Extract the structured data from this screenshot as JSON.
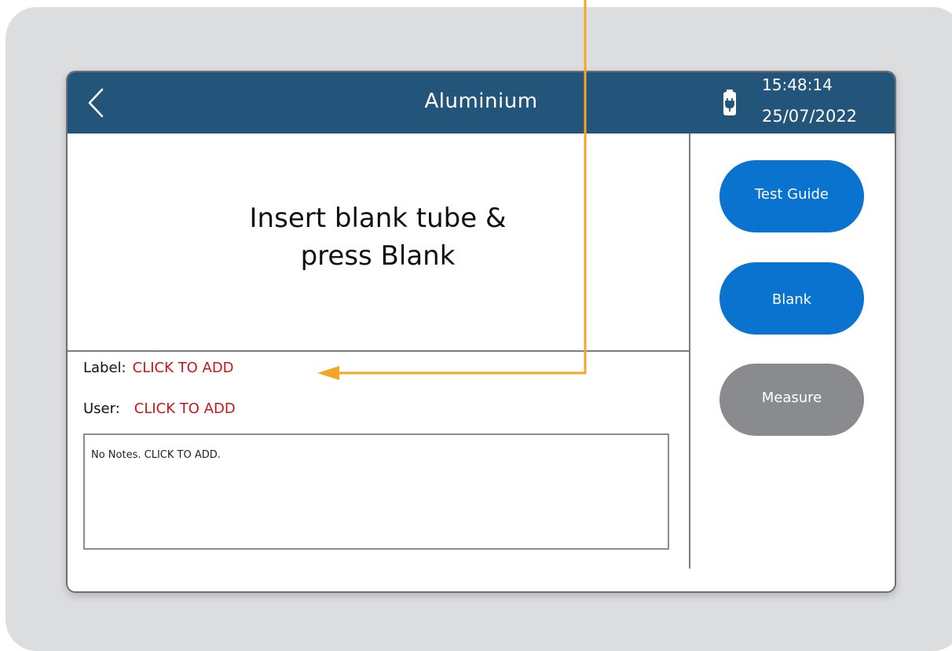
{
  "header": {
    "title": "Aluminium",
    "time": "15:48:14",
    "date": "25/07/2022",
    "color": "#23557a"
  },
  "main": {
    "instruction_line1": "Insert blank tube &",
    "instruction_line2": "press Blank",
    "label_key": "Label:",
    "label_value": "CLICK TO ADD",
    "user_key": "User:",
    "user_value": "CLICK TO ADD",
    "notes_text": "No Notes. CLICK TO ADD."
  },
  "side_buttons": {
    "test_guide": "Test Guide",
    "blank": "Blank",
    "measure": "Measure",
    "active_color": "#0a73cf",
    "disabled_color": "#8a8b8e"
  },
  "icons": {
    "back": "chevron-left-icon",
    "battery": "battery-charging-icon"
  },
  "annotation": {
    "color": "#f5a623"
  }
}
